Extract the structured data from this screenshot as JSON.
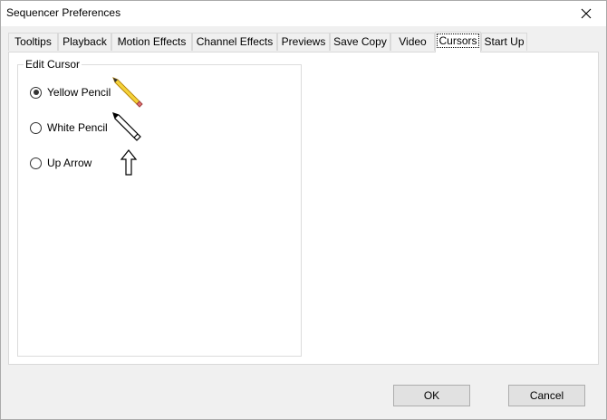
{
  "window": {
    "title": "Sequencer Preferences"
  },
  "tabs": [
    {
      "label": "Tooltips",
      "active": false
    },
    {
      "label": "Playback",
      "active": false
    },
    {
      "label": "Motion Effects",
      "active": false
    },
    {
      "label": "Channel Effects",
      "active": false
    },
    {
      "label": "Previews",
      "active": false
    },
    {
      "label": "Save Copy",
      "active": false
    },
    {
      "label": "Video",
      "active": false
    },
    {
      "label": "Cursors",
      "active": true
    },
    {
      "label": "Start Up",
      "active": false
    }
  ],
  "edit_cursor": {
    "group_label": "Edit Cursor",
    "options": [
      {
        "label": "Yellow Pencil",
        "selected": true,
        "icon": "yellow-pencil-icon"
      },
      {
        "label": "White Pencil",
        "selected": false,
        "icon": "white-pencil-icon"
      },
      {
        "label": "Up Arrow",
        "selected": false,
        "icon": "up-arrow-icon"
      }
    ]
  },
  "buttons": {
    "ok": "OK",
    "cancel": "Cancel"
  },
  "icons": {
    "close": "close-icon"
  }
}
